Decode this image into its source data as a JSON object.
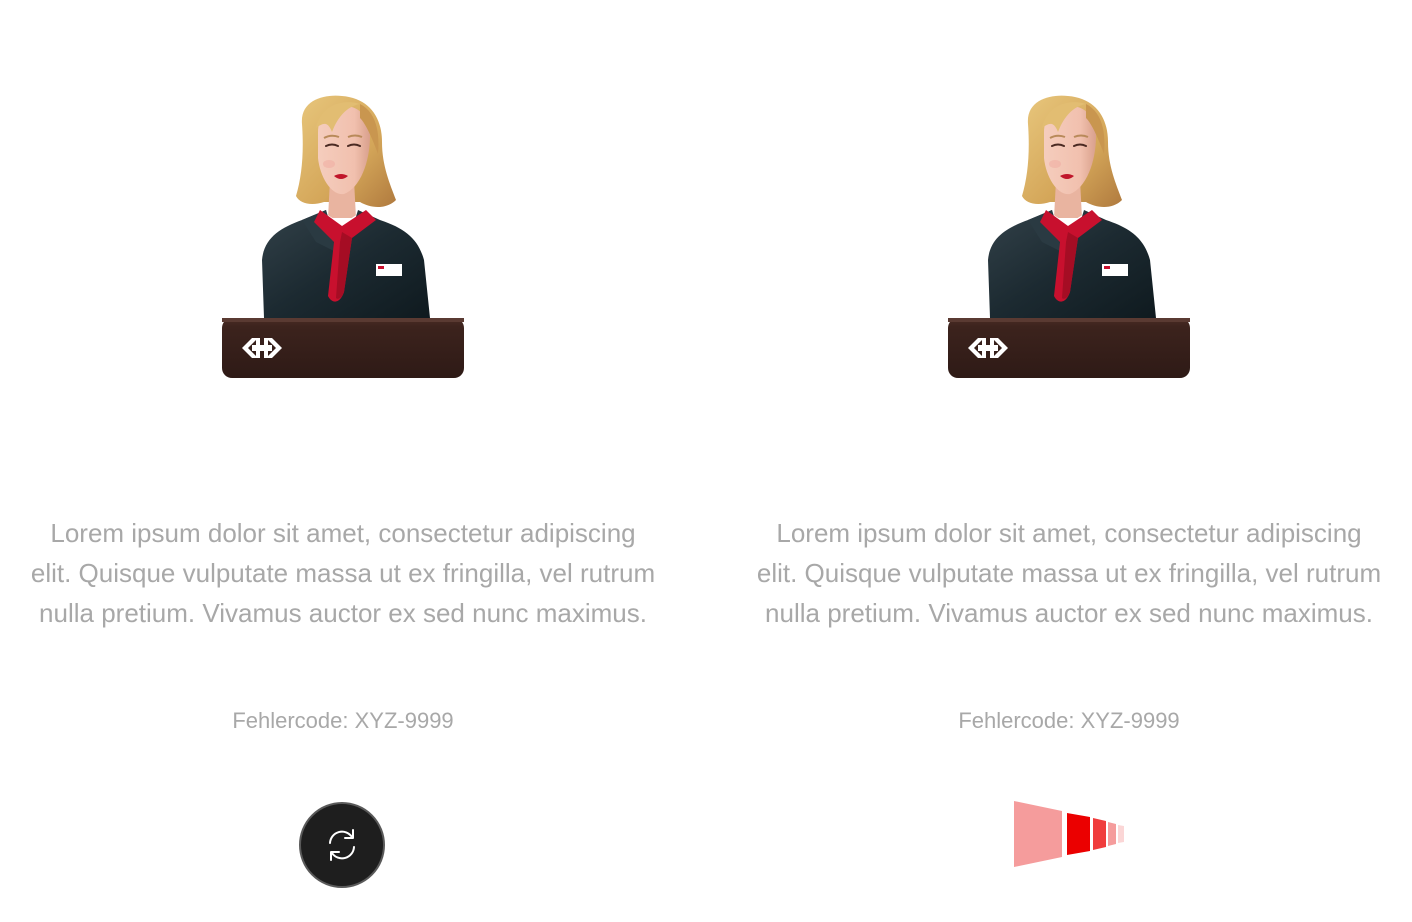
{
  "panels": [
    {
      "illustration": "ticket-agent-illustration",
      "message": "Lorem ipsum dolor sit amet, consectetur adipiscing elit. Quisque vulputate massa ut ex fringilla, vel rutrum nulla pretium. Vivamus auctor ex sed nunc maximus.",
      "error_code": "Fehlercode: XYZ-9999",
      "action": "refresh-icon"
    },
    {
      "illustration": "ticket-agent-illustration",
      "message": "Lorem ipsum dolor sit amet, consectetur adipiscing elit. Quisque vulputate massa ut ex fringilla, vel rutrum nulla pretium. Vivamus auctor ex sed nunc maximus.",
      "error_code": "Fehlercode: XYZ-9999",
      "action": "loading-indicator"
    }
  ],
  "colors": {
    "text": "#a8a8a8",
    "button_bg": "#1e1e1e",
    "accent_red": "#eb0000",
    "accent_light_red": "#f59c9c",
    "desk": "#3a211c",
    "jacket": "#1d2a30",
    "scarf": "#c8102e",
    "hair": "#d9b16a"
  }
}
